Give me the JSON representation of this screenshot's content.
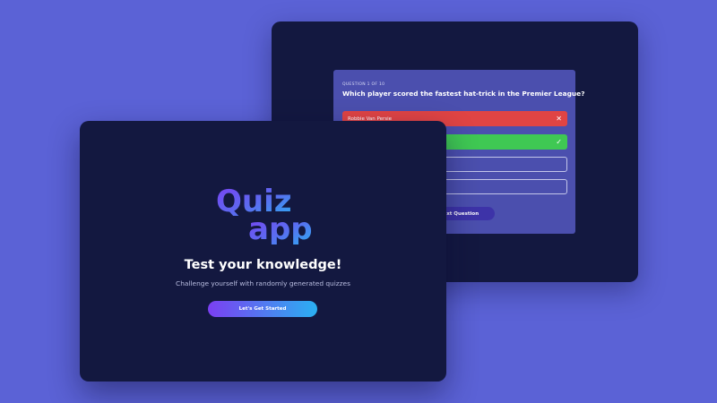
{
  "colors": {
    "background": "#5b62d6",
    "window": "#131840",
    "card": "#4b4fae",
    "wrong": "#e04444",
    "correct": "#3fc853",
    "accent_start": "#7b3ff2",
    "accent_end": "#2ab0f2"
  },
  "question_screen": {
    "counter": "QUESTION 1 OF 10",
    "question": "Which player scored the fastest hat-trick in the Premier League?",
    "answers": [
      {
        "label": "Robbie Van Persie",
        "state": "wrong",
        "icon": "close-icon",
        "mark": "✕"
      },
      {
        "label": "",
        "state": "correct",
        "icon": "check-icon",
        "mark": "✓"
      },
      {
        "label": "",
        "state": "default"
      },
      {
        "label": "",
        "state": "default"
      }
    ],
    "next_label": "Next Question"
  },
  "landing_screen": {
    "logo": {
      "line1": "Quiz",
      "line2": "app"
    },
    "headline": "Test your knowledge!",
    "subline": "Challenge yourself with randomly generated quizzes",
    "start_label": "Let's Get Started"
  }
}
